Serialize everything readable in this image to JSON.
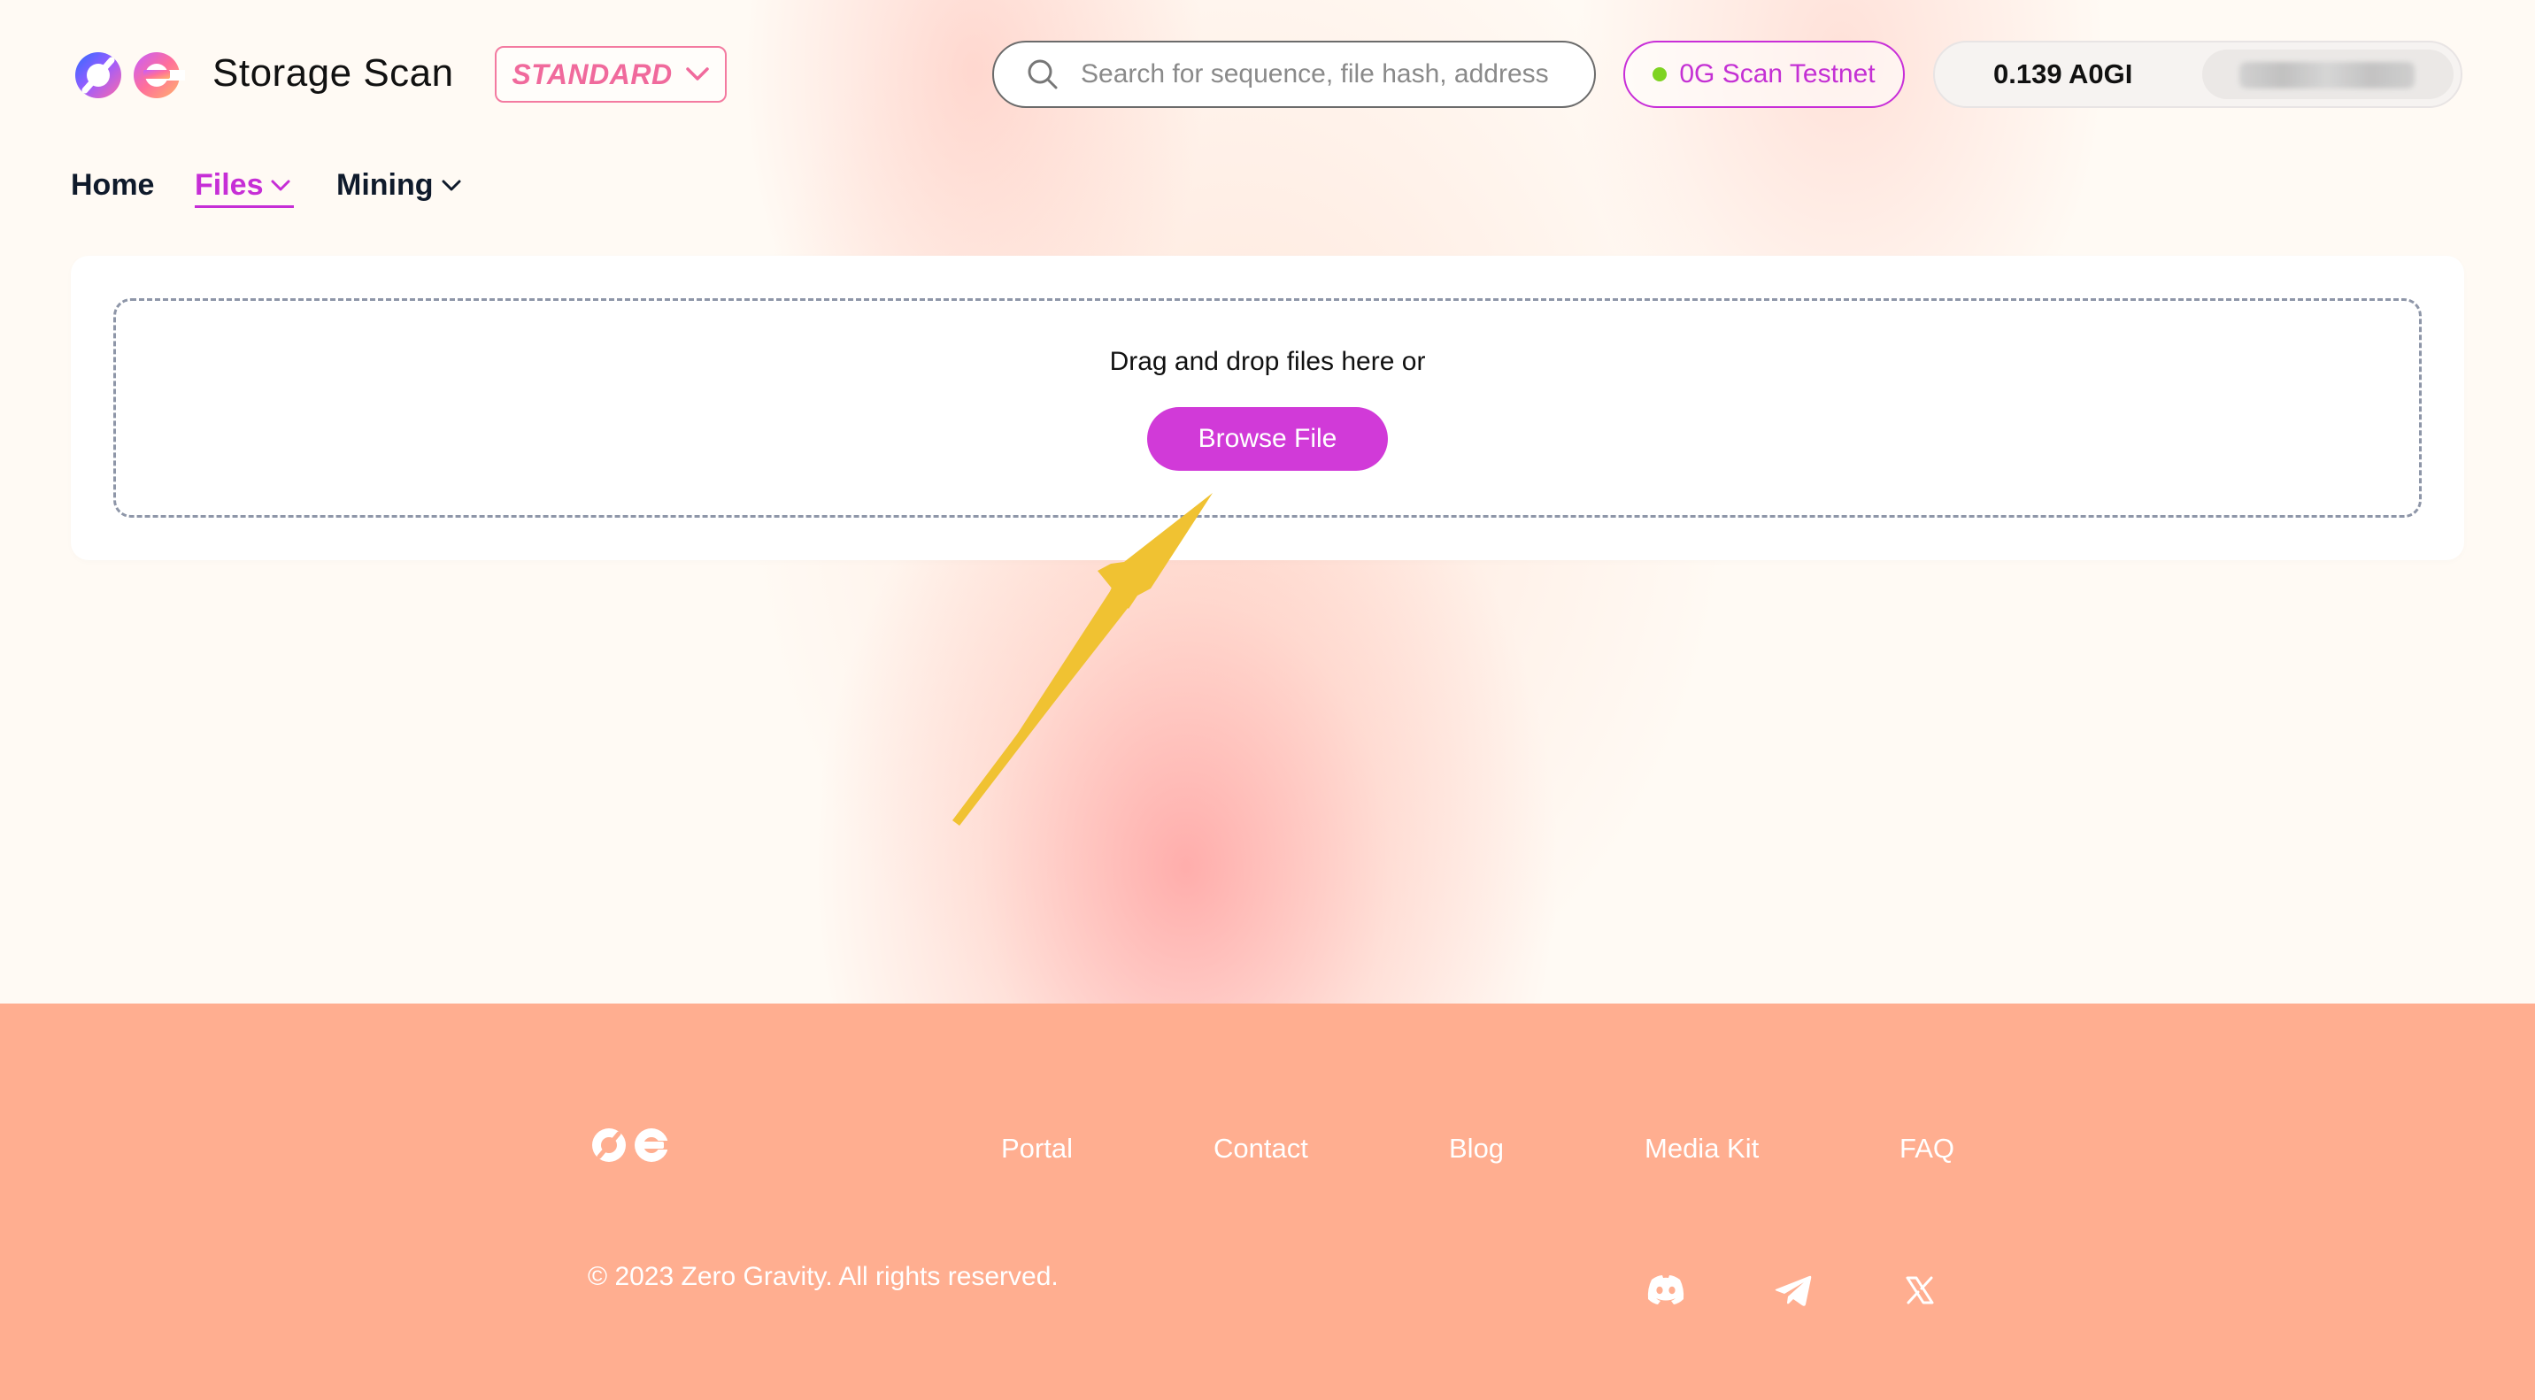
{
  "header": {
    "brand": "Storage Scan",
    "mode_label": "STANDARD",
    "search_placeholder": "Search for sequence, file hash, address",
    "network_label": "0G Scan Testnet",
    "balance": "0.139 A0GI"
  },
  "nav": {
    "home": "Home",
    "files": "Files",
    "mining": "Mining"
  },
  "upload": {
    "instruction": "Drag and drop files here or",
    "browse_label": "Browse File"
  },
  "footer": {
    "links": [
      "Portal",
      "Contact",
      "Blog",
      "Media Kit",
      "FAQ"
    ],
    "copyright": "© 2023 Zero Gravity. All rights reserved.",
    "social_icons": [
      "discord-icon",
      "telegram-icon",
      "x-icon"
    ]
  },
  "colors": {
    "accent": "#c62ed6",
    "button": "#d13ad8",
    "footer_bg": "#ffae90",
    "mode_border": "#f37aa0",
    "status_online": "#7ed321",
    "annotation_arrow": "#f0c232"
  }
}
